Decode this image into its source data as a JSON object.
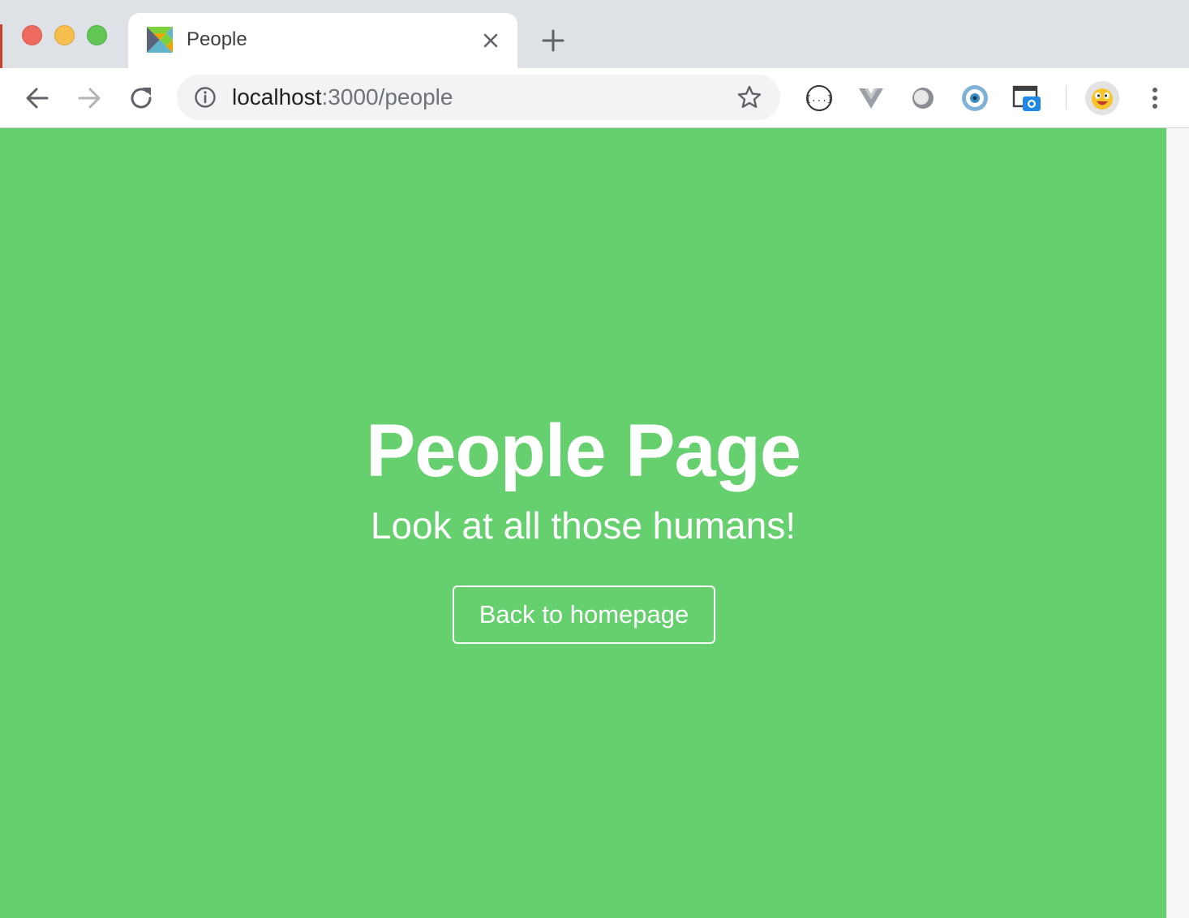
{
  "browser": {
    "tab": {
      "title": "People"
    },
    "address_bar": {
      "host": "localhost",
      "path": ":3000/people"
    },
    "extensions": [
      "json-viewer-icon",
      "vue-devtools-icon",
      "round-extension-icon",
      "eye-extension-icon",
      "screenshot-extension-icon"
    ]
  },
  "page": {
    "heading": "People Page",
    "subtitle": "Look at all those humans!",
    "back_button_label": "Back to homepage",
    "background_color": "#66cf6e",
    "text_color": "#ffffff"
  }
}
